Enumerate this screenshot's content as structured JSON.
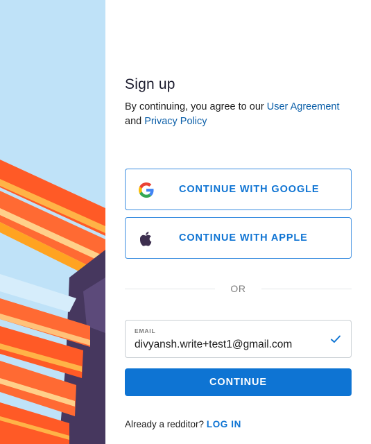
{
  "signup": {
    "title": "Sign up",
    "agreement": {
      "prefix": "By continuing, you agree to our",
      "user_agreement_link": "User Agreement",
      "conjunction": "and",
      "privacy_policy_link": "Privacy Policy"
    },
    "google_button": {
      "label": "CONTINUE WITH GOOGLE",
      "icon": "google-icon"
    },
    "apple_button": {
      "label": "CONTINUE WITH APPLE",
      "icon": "apple-icon"
    },
    "divider_text": "OR",
    "email": {
      "label": "EMAIL",
      "value": "divyansh.write+test1@gmail.com",
      "valid_icon": "checkmark-icon"
    },
    "continue_label": "CONTINUE",
    "footer": {
      "prompt": "Already a redditor?",
      "login_link": "LOG IN"
    }
  },
  "colors": {
    "accent_blue": "#0e74d3",
    "link_blue": "#0a5ea8",
    "art_background": "#bfe2f8",
    "art_orange": "#ff6a33",
    "art_amber": "#ffa321",
    "art_purple": "#46375e"
  }
}
